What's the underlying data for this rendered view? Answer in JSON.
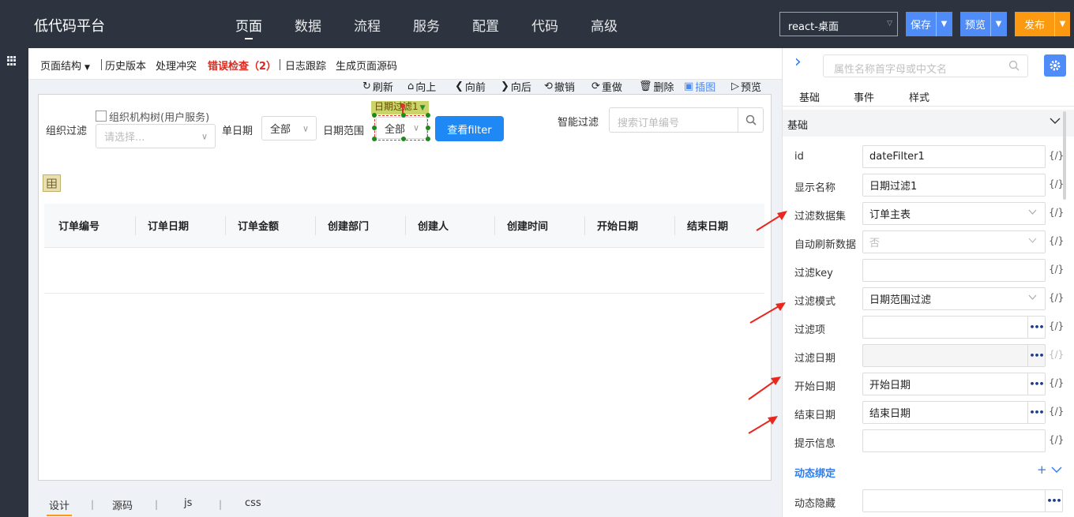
{
  "app": {
    "title": "低代码平台"
  },
  "nav": {
    "items": [
      "页面",
      "数据",
      "流程",
      "服务",
      "配置",
      "代码",
      "高级"
    ],
    "active": 0
  },
  "env_select": {
    "value": "react-桌面"
  },
  "actions": {
    "save": "保存",
    "preview": "预览",
    "publish": "发布"
  },
  "subtoolbar": {
    "page_structure": "页面结构",
    "history": "历史版本",
    "conflict": "处理冲突",
    "error_check": "错误检查（2）",
    "log_trace": "日志跟踪",
    "gen_source": "生成页面源码"
  },
  "design_ops": {
    "refresh": "刷新",
    "up": "向上",
    "forward": "向前",
    "backward": "向后",
    "undo": "撤销",
    "redo": "重做",
    "delete": "删除",
    "screenshot": "插图",
    "preview": "预览"
  },
  "filter": {
    "org_label": "组织过滤",
    "org_tree_label": "组织机构树(用户服务)",
    "org_placeholder": "请选择...",
    "single_date_label": "单日期",
    "single_date_value": "全部",
    "date_range_label": "日期范围",
    "date_range_value": "全部",
    "selection_tag": "日期过滤1",
    "query_button": "查看filter",
    "smart_label": "智能过滤",
    "smart_placeholder": "搜索订单编号"
  },
  "table": {
    "columns": [
      "订单编号",
      "订单日期",
      "订单金额",
      "创建部门",
      "创建人",
      "创建时间",
      "开始日期",
      "结束日期"
    ]
  },
  "bottom_tabs": {
    "items": [
      "设计",
      "源码",
      "js",
      "css"
    ],
    "active": 0
  },
  "props": {
    "search_placeholder": "属性名称首字母或中文名",
    "tabs": [
      "基础",
      "事件",
      "样式"
    ],
    "section": "基础",
    "fx": "{/}",
    "rows": [
      {
        "label": "id",
        "value": "dateFilter1"
      },
      {
        "label": "显示名称",
        "value": "日期过滤1"
      },
      {
        "label": "过滤数据集",
        "value": "订单主表"
      },
      {
        "label": "自动刷新数据",
        "value": "否"
      },
      {
        "label": "过滤key",
        "value": ""
      },
      {
        "label": "过滤模式",
        "value": "日期范围过滤"
      },
      {
        "label": "过滤项",
        "value": ""
      },
      {
        "label": "过滤日期",
        "value": ""
      },
      {
        "label": "开始日期",
        "value": "开始日期"
      },
      {
        "label": "结束日期",
        "value": "结束日期"
      },
      {
        "label": "提示信息",
        "value": ""
      }
    ],
    "dynamic_section": "动态绑定",
    "dynamic_rows": [
      {
        "label": "动态隐藏",
        "value": ""
      }
    ]
  },
  "colors": {
    "topbar": "#2d3440",
    "primary": "#1e88f5",
    "save_blue": "#4f8cf7",
    "publish_orange": "#fb9a10",
    "error_red": "#e0271c",
    "annotation_red": "#e8281e"
  }
}
